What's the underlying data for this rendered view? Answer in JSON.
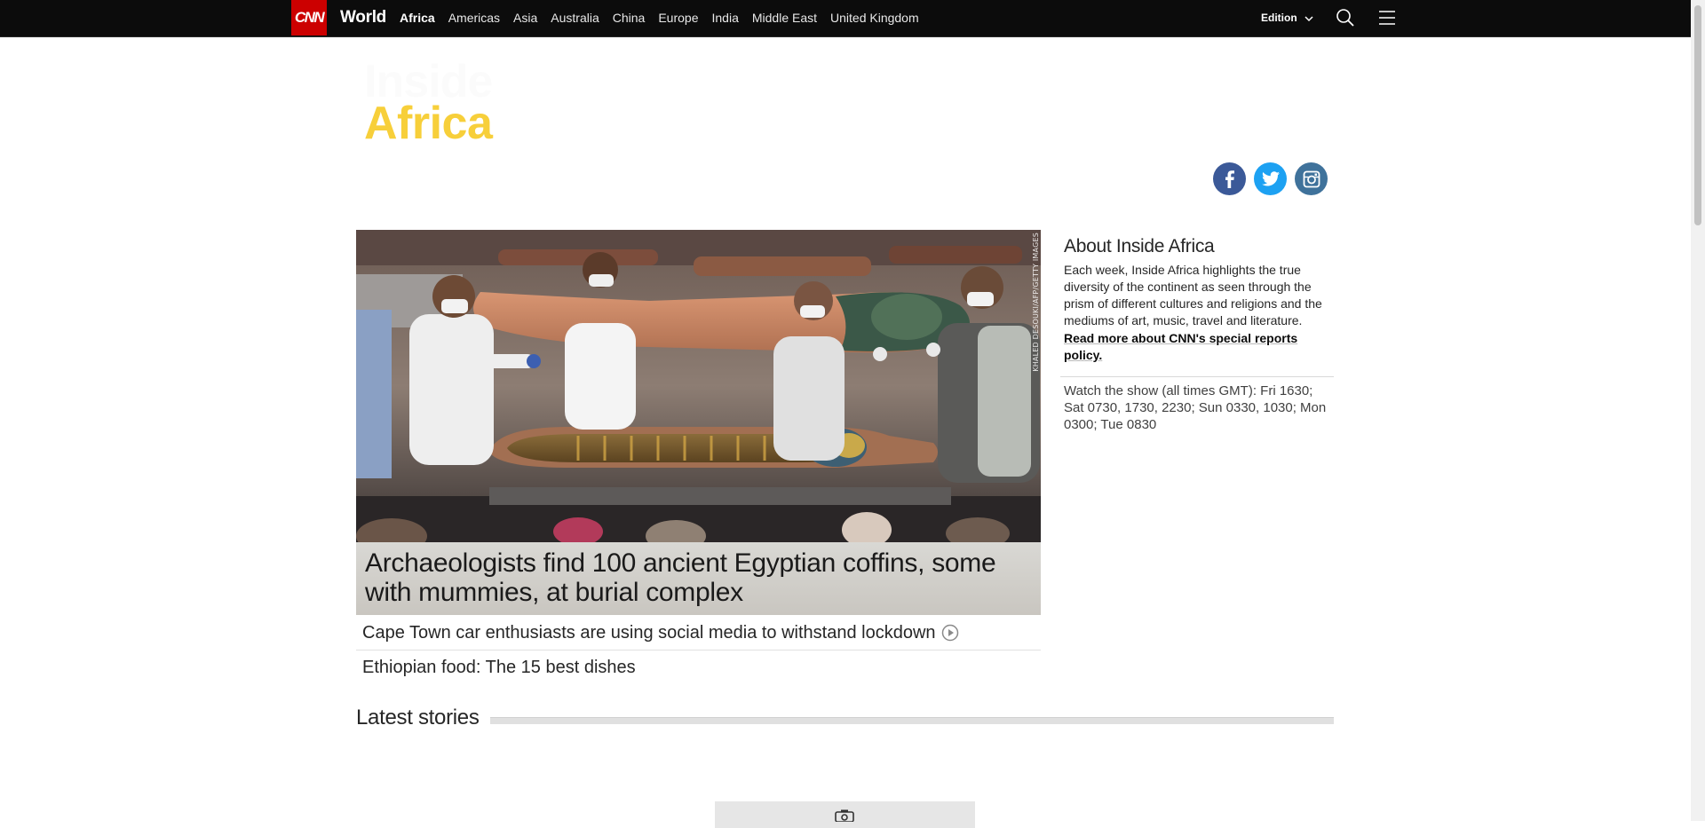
{
  "topnav": {
    "logo": "CNN",
    "section": "World",
    "links": [
      "Africa",
      "Americas",
      "Asia",
      "Australia",
      "China",
      "Europe",
      "India",
      "Middle East",
      "United Kingdom"
    ],
    "active_link": "Africa",
    "edition_label": "Edition",
    "icons": [
      "search-icon",
      "menu-icon",
      "chevron-down-icon"
    ]
  },
  "header": {
    "brand_top": "Inside",
    "brand_bottom": "Africa",
    "social_icons": [
      "facebook-icon",
      "twitter-icon",
      "instagram-icon"
    ]
  },
  "hero": {
    "image_credit": "KHALED DESOUKI/AFP/GETTY IMAGES",
    "headline": "Archaeologists find 100 ancient Egyptian coffins, some with mummies, at burial complex"
  },
  "stories": [
    {
      "title": "Cape Town car enthusiasts are using social media to withstand lockdown",
      "icon": "play-icon"
    },
    {
      "title": "Ethiopian food: The 15 best dishes"
    }
  ],
  "sidebar": {
    "about_title": "About Inside Africa",
    "about_body": "Each week, Inside Africa highlights the true diversity of the continent as seen through the prism of different cultures and religions and the mediums of art, music, travel and literature.",
    "policy_link": "Read more about CNN's special reports policy.",
    "watch_text": "Watch the show (all times GMT): Fri 1630; Sat 0730, 1730, 2230; Sun 0330, 1030; Mon 0300; Tue 0830"
  },
  "latest": {
    "title": "Latest stories"
  },
  "colors": {
    "nav_bg": "#0c0c0c",
    "cnn_red": "#cc0000",
    "brand_yellow": "#f7cf3a",
    "facebook": "#3b5998",
    "twitter": "#1da1f2",
    "instagram": "#3f729b"
  }
}
